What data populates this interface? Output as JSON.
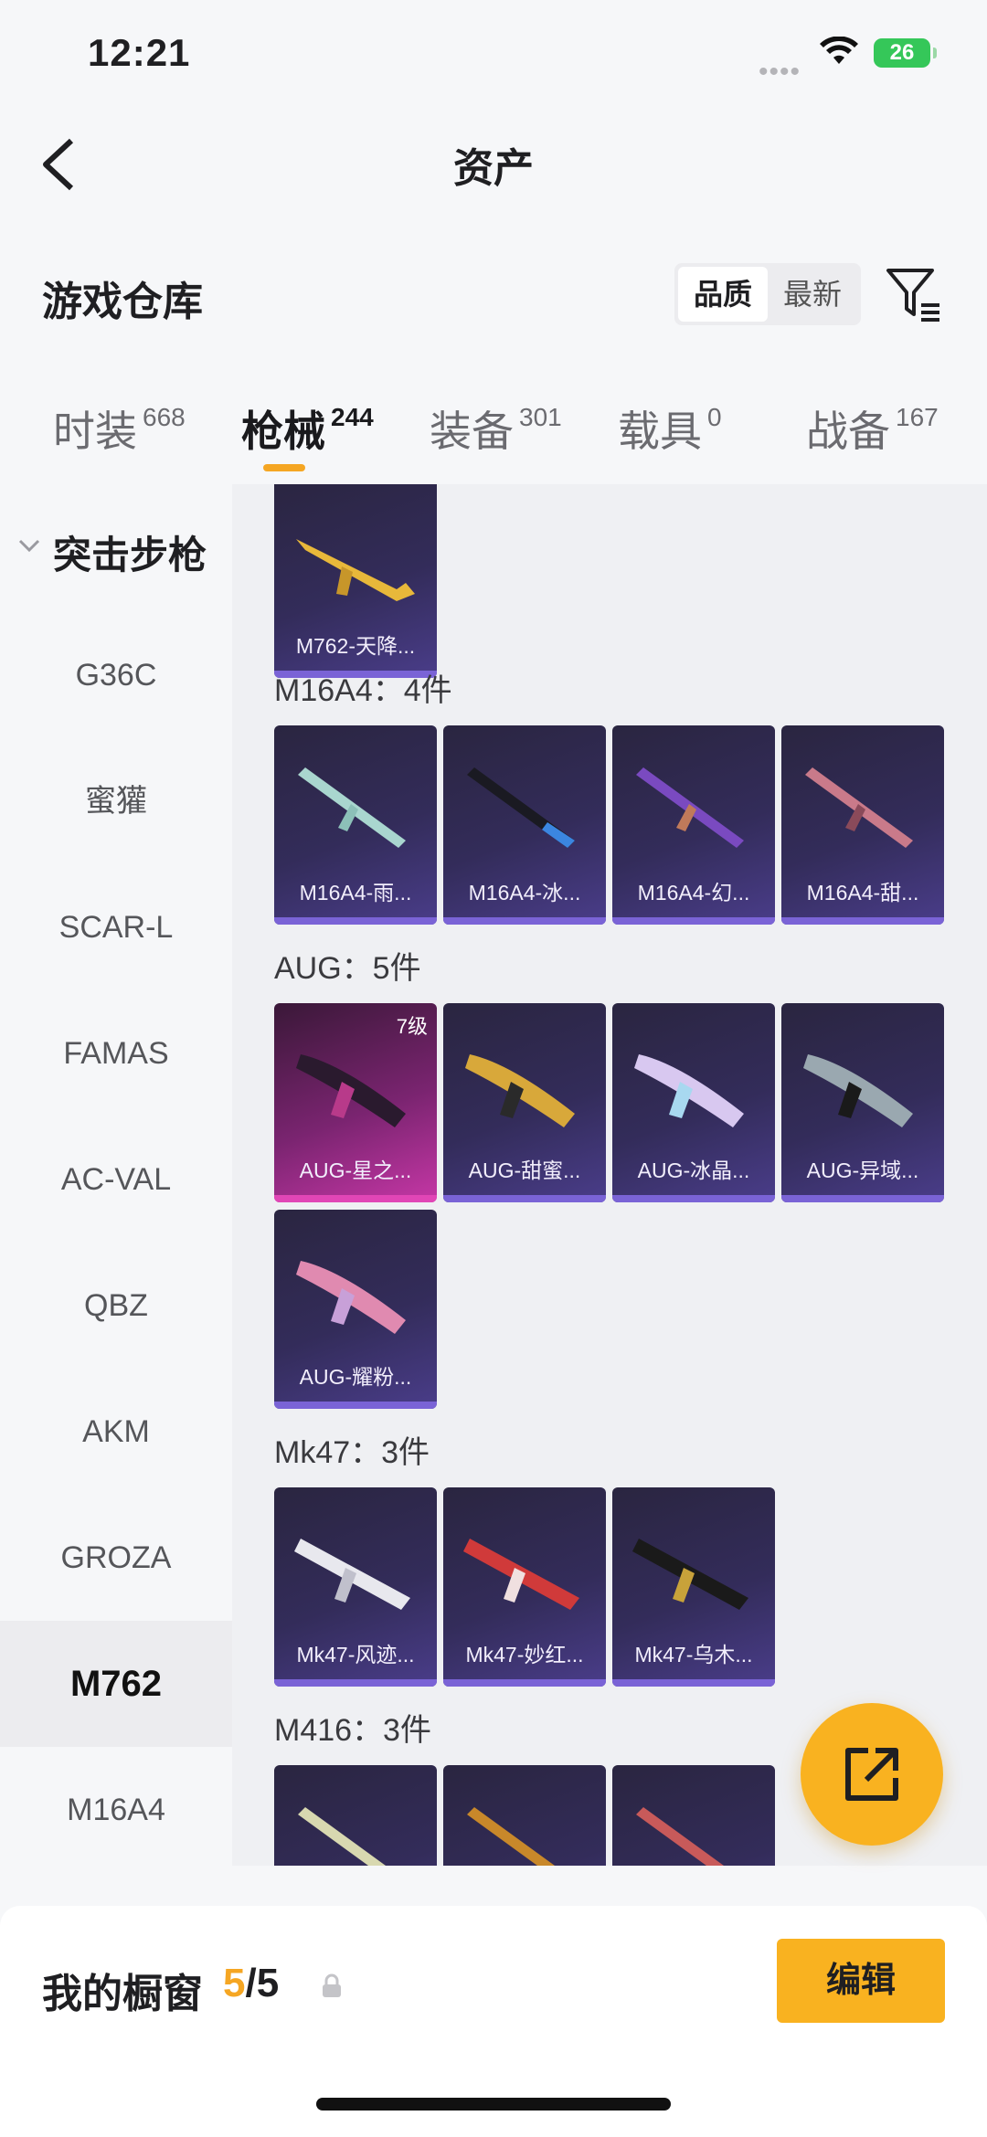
{
  "status_bar": {
    "time": "12:21",
    "battery": "26"
  },
  "nav": {
    "title": "资产"
  },
  "section": {
    "title": "游戏仓库",
    "sort_options": [
      "品质",
      "最新"
    ]
  },
  "tabs": [
    {
      "label": "时装",
      "count": "668"
    },
    {
      "label": "枪械",
      "count": "244"
    },
    {
      "label": "装备",
      "count": "301"
    },
    {
      "label": "载具",
      "count": "0"
    },
    {
      "label": "战备",
      "count": "167"
    }
  ],
  "sidebar": {
    "category": "突击步枪",
    "items": [
      "G36C",
      "蜜獾",
      "SCAR-L",
      "FAMAS",
      "AC-VAL",
      "QBZ",
      "AKM",
      "GROZA",
      "M762",
      "M16A4"
    ]
  },
  "groups": [
    {
      "label": "",
      "items": [
        {
          "name": "M762-天降..."
        }
      ]
    },
    {
      "label": "M16A4：4件",
      "items": [
        {
          "name": "M16A4-雨..."
        },
        {
          "name": "M16A4-冰..."
        },
        {
          "name": "M16A4-幻..."
        },
        {
          "name": "M16A4-甜..."
        }
      ]
    },
    {
      "label": "AUG：5件",
      "items": [
        {
          "name": "AUG-星之...",
          "level": "7级"
        },
        {
          "name": "AUG-甜蜜..."
        },
        {
          "name": "AUG-冰晶..."
        },
        {
          "name": "AUG-异域..."
        },
        {
          "name": "AUG-耀粉..."
        }
      ]
    },
    {
      "label": "Mk47：3件",
      "items": [
        {
          "name": "Mk47-风迹..."
        },
        {
          "name": "Mk47-妙红..."
        },
        {
          "name": "Mk47-乌木..."
        }
      ]
    },
    {
      "label": "M416：3件",
      "items": [
        {
          "name": ""
        },
        {
          "name": ""
        },
        {
          "name": ""
        }
      ]
    }
  ],
  "showcase": {
    "title": "我的橱窗",
    "current": "5",
    "total": "/5",
    "edit_label": "编辑"
  },
  "colors": {
    "accent": "#f9b220",
    "card_purple": "#332c5a",
    "card_pink": "#c637a6"
  }
}
